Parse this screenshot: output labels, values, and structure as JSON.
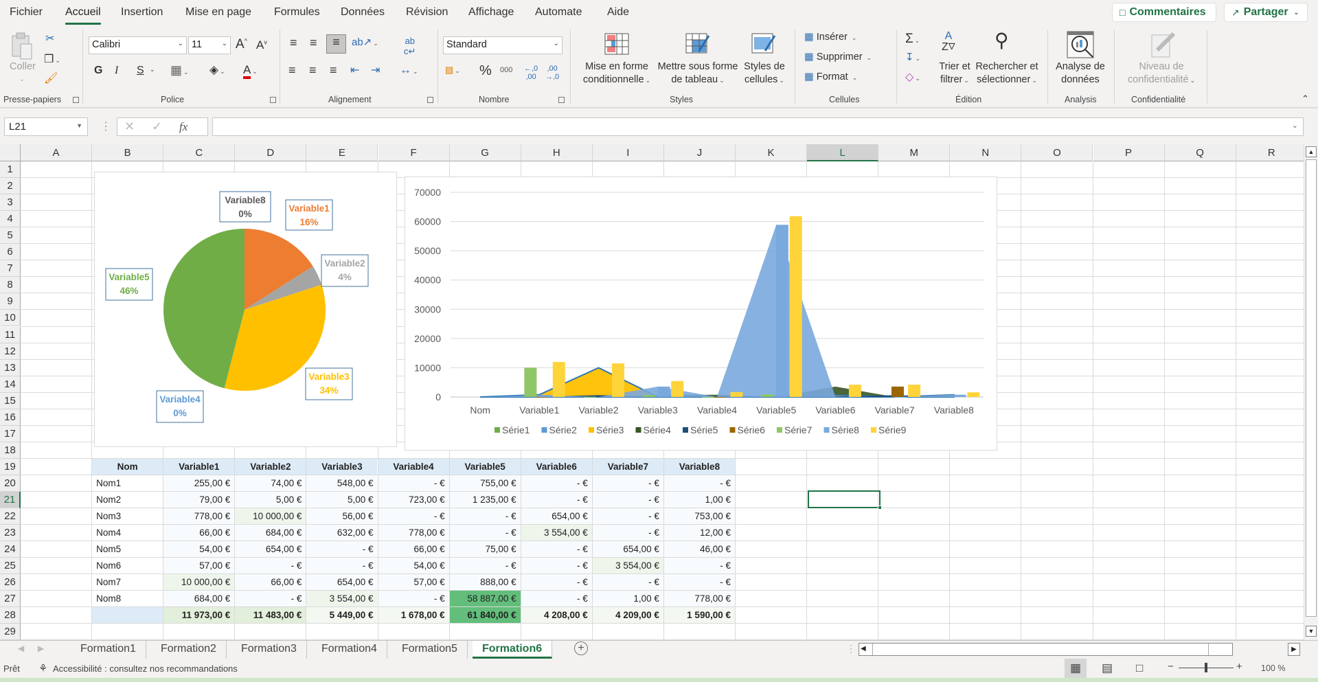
{
  "menu": {
    "tabs": [
      "Fichier",
      "Accueil",
      "Insertion",
      "Mise en page",
      "Formules",
      "Données",
      "Révision",
      "Affichage",
      "Automate",
      "Aide"
    ],
    "active": "Accueil",
    "comments_label": "Commentaires",
    "share_label": "Partager"
  },
  "ribbon": {
    "clipboard": {
      "paste_label": "Coller",
      "group_label": "Presse-papiers"
    },
    "font": {
      "family": "Calibri",
      "size": "11",
      "bold": "G",
      "italic": "I",
      "underline": "S",
      "group_label": "Police",
      "font_color": "#e00000"
    },
    "alignment": {
      "group_label": "Alignement"
    },
    "number": {
      "format": "Standard",
      "percent": "%",
      "thousands": "000",
      "group_label": "Nombre"
    },
    "styles": {
      "conditional": [
        "Mise en forme",
        "conditionnelle"
      ],
      "table": [
        "Mettre sous forme",
        "de tableau"
      ],
      "cell_styles": [
        "Styles de",
        "cellules"
      ],
      "group_label": "Styles"
    },
    "cells": {
      "insert": "Insérer",
      "delete": "Supprimer",
      "format": "Format",
      "group_label": "Cellules"
    },
    "editing": {
      "sort": [
        "Trier et",
        "filtrer"
      ],
      "find": [
        "Rechercher et",
        "sélectionner"
      ],
      "group_label": "Édition"
    },
    "analysis": {
      "label": [
        "Analyse de",
        "données"
      ],
      "group_label": "Analysis"
    },
    "sensitivity": {
      "label": [
        "Niveau de",
        "confidentialité"
      ],
      "group_label": "Confidentialité"
    }
  },
  "formula_bar": {
    "name_box": "L21",
    "formula": "",
    "fx": "fx"
  },
  "grid": {
    "columns": [
      "A",
      "B",
      "C",
      "D",
      "E",
      "F",
      "G",
      "H",
      "I",
      "J",
      "K",
      "L",
      "M",
      "N",
      "O",
      "P",
      "Q",
      "R"
    ],
    "rows": [
      "1",
      "2",
      "3",
      "4",
      "5",
      "6",
      "7",
      "8",
      "9",
      "10",
      "11",
      "12",
      "13",
      "14",
      "15",
      "16",
      "17",
      "18",
      "19",
      "20",
      "21",
      "22",
      "23",
      "24",
      "25",
      "26",
      "27",
      "28",
      "29"
    ],
    "selected_cell": "L21"
  },
  "table": {
    "headers": [
      "Nom",
      "Variable1",
      "Variable2",
      "Variable3",
      "Variable4",
      "Variable5",
      "Variable6",
      "Variable7",
      "Variable8"
    ],
    "rows": [
      [
        "Nom1",
        "255,00 €",
        "74,00 €",
        "548,00 €",
        "-   €",
        "755,00 €",
        "-   €",
        "-   €",
        "-   €"
      ],
      [
        "Nom2",
        "79,00 €",
        "5,00 €",
        "5,00 €",
        "723,00 €",
        "1 235,00 €",
        "-   €",
        "-   €",
        "1,00 €"
      ],
      [
        "Nom3",
        "778,00 €",
        "10 000,00 €",
        "56,00 €",
        "-   €",
        "-   €",
        "654,00 €",
        "-   €",
        "753,00 €"
      ],
      [
        "Nom4",
        "66,00 €",
        "684,00 €",
        "632,00 €",
        "778,00 €",
        "-   €",
        "3 554,00 €",
        "-   €",
        "12,00 €"
      ],
      [
        "Nom5",
        "54,00 €",
        "654,00 €",
        "-   €",
        "66,00 €",
        "75,00 €",
        "-   €",
        "654,00 €",
        "46,00 €"
      ],
      [
        "Nom6",
        "57,00 €",
        "-   €",
        "-   €",
        "54,00 €",
        "-   €",
        "-   €",
        "3 554,00 €",
        "-   €"
      ],
      [
        "Nom7",
        "10 000,00 €",
        "66,00 €",
        "654,00 €",
        "57,00 €",
        "888,00 €",
        "-   €",
        "-   €",
        "-   €"
      ],
      [
        "Nom8",
        "684,00 €",
        "-   €",
        "3 554,00 €",
        "-   €",
        "58 887,00 €",
        "-   €",
        "1,00 €",
        "778,00 €"
      ]
    ],
    "totals": [
      "",
      "11 973,00 €",
      "11 483,00 €",
      "5 449,00 €",
      "1 678,00 €",
      "61 840,00 €",
      "4 208,00 €",
      "4 209,00 €",
      "1 590,00 €"
    ]
  },
  "chart_data": [
    {
      "type": "pie",
      "title": "",
      "categories": [
        "Variable1",
        "Variable2",
        "Variable3",
        "Variable4",
        "Variable5",
        "Variable8"
      ],
      "values": [
        16,
        4,
        34,
        0,
        46,
        0
      ],
      "labels": [
        "Variable1\n16%",
        "Variable2\n4%",
        "Variable3\n34%",
        "Variable4\n0%",
        "Variable5\n46%",
        "Variable8\n0%"
      ],
      "colors": {
        "Variable1": "#ed7d31",
        "Variable2": "#a5a5a5",
        "Variable3": "#ffc000",
        "Variable4": "#5b9bd5",
        "Variable5": "#70ad47",
        "Variable8": "#595959"
      }
    },
    {
      "type": "bar",
      "title": "",
      "categories": [
        "Nom",
        "Variable1",
        "Variable2",
        "Variable3",
        "Variable4",
        "Variable5",
        "Variable6",
        "Variable7",
        "Variable8"
      ],
      "ylim": [
        0,
        70000
      ],
      "yticks": [
        0,
        10000,
        20000,
        30000,
        40000,
        50000,
        60000,
        70000
      ],
      "grid": true,
      "legend": "bottom",
      "series": [
        {
          "name": "Série1",
          "color": "#70ad47",
          "values": [
            0,
            255,
            74,
            548,
            0,
            755,
            0,
            0,
            0
          ]
        },
        {
          "name": "Série2",
          "color": "#5b9bd5",
          "values": [
            0,
            79,
            5,
            5,
            723,
            1235,
            0,
            0,
            1
          ]
        },
        {
          "name": "Série3",
          "color": "#ffc000",
          "values": [
            0,
            778,
            10000,
            56,
            0,
            0,
            654,
            0,
            753
          ]
        },
        {
          "name": "Série4",
          "color": "#375623",
          "values": [
            0,
            66,
            684,
            632,
            778,
            0,
            3554,
            0,
            12
          ]
        },
        {
          "name": "Série5",
          "color": "#1f4e79",
          "values": [
            0,
            54,
            654,
            0,
            66,
            75,
            0,
            654,
            46
          ]
        },
        {
          "name": "Série6",
          "color": "#9c6500",
          "values": [
            0,
            57,
            0,
            0,
            54,
            0,
            0,
            3554,
            0
          ]
        },
        {
          "name": "Série7",
          "color": "#8fc766",
          "values": [
            0,
            10000,
            66,
            654,
            57,
            888,
            0,
            0,
            0
          ]
        },
        {
          "name": "Série8",
          "color": "#7aa9dd",
          "values": [
            0,
            684,
            0,
            3554,
            0,
            58887,
            0,
            1,
            778
          ]
        },
        {
          "name": "Série9",
          "color": "#ffd43b",
          "values": [
            0,
            11973,
            11483,
            5449,
            1678,
            61840,
            4208,
            4209,
            1590
          ]
        }
      ]
    }
  ],
  "sheets": {
    "tabs": [
      "Formation1",
      "Formation2",
      "Formation3",
      "Formation4",
      "Formation5",
      "Formation6"
    ],
    "active": "Formation6"
  },
  "status": {
    "ready": "Prêt",
    "accessibility": "Accessibilité : consultez nos recommandations",
    "zoom": "100 %"
  }
}
